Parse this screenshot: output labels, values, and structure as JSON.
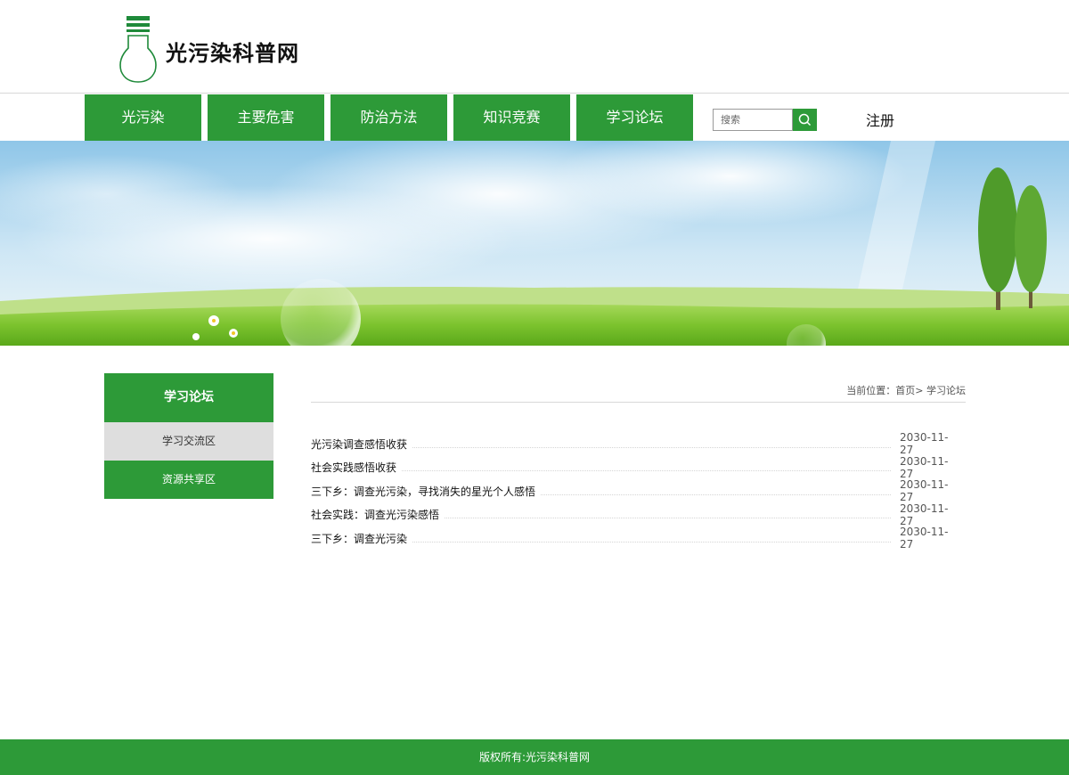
{
  "header": {
    "site_title": "光污染科普网",
    "logo_icon": "lightbulb-logo-icon"
  },
  "nav": {
    "items": [
      "光污染",
      "主要危害",
      "防治方法",
      "知识竞赛",
      "学习论坛"
    ],
    "search_placeholder": "搜索",
    "search_icon": "search-icon",
    "register_label": "注册"
  },
  "sidebar": {
    "title": "学习论坛",
    "items": [
      "学习交流区",
      "资源共享区"
    ]
  },
  "breadcrumb": {
    "label": "当前位置：",
    "home": "首页>",
    "current": "学习论坛"
  },
  "articles": [
    {
      "title": "光污染调查感悟收获",
      "date": "2030-11-27"
    },
    {
      "title": "社会实践感悟收获",
      "date": "2030-11-27"
    },
    {
      "title": "三下乡：调查光污染，寻找消失的星光个人感悟",
      "date": "2030-11-27"
    },
    {
      "title": "社会实践：调查光污染感悟",
      "date": "2030-11-27"
    },
    {
      "title": "三下乡：调查光污染",
      "date": "2030-11-27"
    }
  ],
  "footer": {
    "copyright": "版权所有:光污染科普网"
  },
  "colors": {
    "brand_green": "#2d9a38",
    "sidebar_active_gray": "#dedede"
  }
}
